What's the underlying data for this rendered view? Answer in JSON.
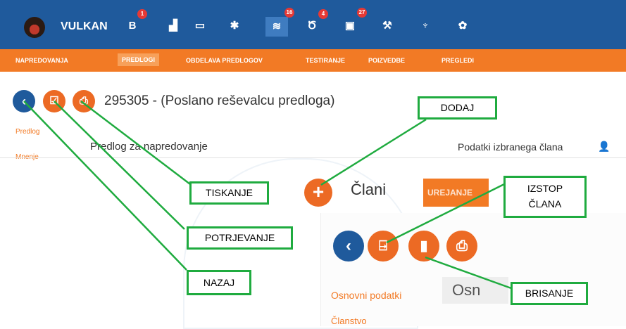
{
  "topbar": {
    "brand": "VULKAN",
    "badges": [
      "1",
      "16",
      "4",
      "27"
    ]
  },
  "nav_items": [
    "NAPREDOVANJA",
    "PREDLOGI",
    "OBDELAVA PREDLOGOV",
    "TESTIRANJE",
    "POIZVEDBE",
    "PREGLEDI"
  ],
  "page": {
    "title": "295305 - (Poslano reševalcu predloga)",
    "side_tabs": [
      "Predlog",
      "Mnenje"
    ],
    "proposal_heading": "Predlog za napredovanje",
    "member_info": "Podatki izbranega člana"
  },
  "members_panel": {
    "title": "Člani",
    "tab": "UREJANJE",
    "section_basic": "Osnovni podatki",
    "section_basic_box": "Osn",
    "section_membership": "Članstvo"
  },
  "callouts": {
    "dodaj": "DODAJ",
    "tiskanje": "TISKANJE",
    "potrjevanje": "POTRJEVANJE",
    "nazaj": "NAZAJ",
    "izstop": "IZSTOP ČLANA",
    "brisanje": "BRISANJE"
  },
  "colors": {
    "primary_blue": "#1f5a9c",
    "accent_orange": "#f27a25",
    "callout_green": "#1fab3f"
  },
  "icons": [
    "back-icon",
    "confirm-icon",
    "print-icon",
    "add-icon",
    "exit-member-icon",
    "delete-icon"
  ]
}
